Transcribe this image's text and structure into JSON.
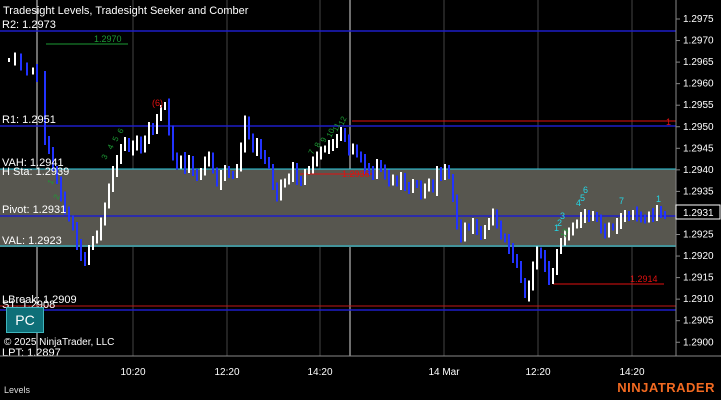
{
  "chart": {
    "title": "Tradesight Levels, Tradesight Seeker and Comber",
    "copyright": "© 2025 NinjaTrader, LLC",
    "price_labels": [
      "1.2975",
      "1.2970",
      "1.2965",
      "1.2960",
      "1.2955",
      "1.2950",
      "1.2945",
      "1.2940",
      "1.2935",
      "1.2930",
      "1.2925",
      "1.2920",
      "1.2915",
      "1.2910",
      "1.2905",
      "1.2900"
    ],
    "current_price": "1.2931",
    "time_labels": [
      "10:20",
      "12:20",
      "14:20",
      "14 Mar",
      "12:20",
      "14:20"
    ],
    "levels": {
      "r2": "R2: 1.2973",
      "r1": "R1: 1.2951",
      "vah": "VAH: 1.2941",
      "r_overlap": "H Sta: 1.2939",
      "pivot": "Pivot: 1.2931",
      "val": "VAL: 1.2923",
      "lbreak": "LBreak: 1.2909",
      "s_overlap": "S1: 1.2908",
      "lpt": "LPT: 1.2897"
    },
    "annotations": {
      "green_top": "1.2970",
      "red_mid": "1.2936",
      "red_right": "1.2914",
      "red_one": "1",
      "red_circle": "(6)"
    },
    "seeker_numbers": [
      "1",
      "2",
      "3",
      "4",
      "5",
      "6",
      "7",
      "1"
    ],
    "comber_numbers": [
      "1",
      "2",
      "3",
      "4",
      "5",
      "6",
      "7",
      "8",
      "9",
      "10",
      "11",
      "12",
      "13"
    ]
  },
  "ui": {
    "pc_button": "PC",
    "bottom_tab": "Levels",
    "brand": "NINJATRADER"
  },
  "colors": {
    "background": "#000000",
    "level_blue": "#1e1ec8",
    "value_area_band": "#57564f",
    "value_area_line": "#2fd0e6",
    "up_bar": "#ffffff",
    "down_bar": "#2233ff",
    "seeker_cyan": "#23d7e6",
    "comber_green": "#1d9a35",
    "red": "#e01010",
    "brand": "#f26a21"
  }
}
